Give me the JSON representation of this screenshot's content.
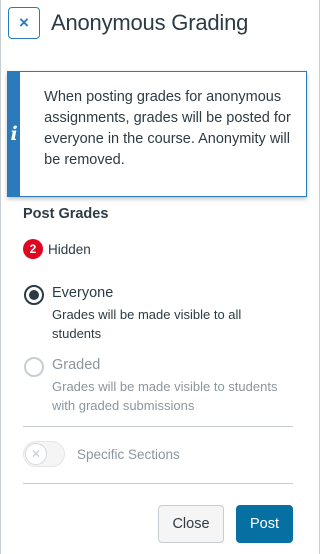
{
  "header": {
    "close_glyph": "×",
    "title": "Anonymous Grading"
  },
  "alert": {
    "icon_glyph": "i",
    "message": "When posting grades for anonymous assignments, grades will be posted for everyone in the course. Anonymity will be removed."
  },
  "post_grades": {
    "section_title": "Post Grades",
    "hidden_count": "2",
    "hidden_label": "Hidden"
  },
  "options": [
    {
      "label": "Everyone",
      "description": "Grades will be made visible to all students",
      "selected": true,
      "disabled": false
    },
    {
      "label": "Graded",
      "description": "Grades will be made visible to students with graded submissions",
      "selected": false,
      "disabled": true
    }
  ],
  "specific_sections": {
    "label": "Specific Sections",
    "toggle_glyph": "✕",
    "enabled": false
  },
  "footer": {
    "close_label": "Close",
    "post_label": "Post"
  },
  "colors": {
    "accent": "#2b7abc",
    "primary_button": "#0770a3",
    "badge": "#e0061f",
    "text": "#2d3b45",
    "muted": "#8b969e"
  }
}
